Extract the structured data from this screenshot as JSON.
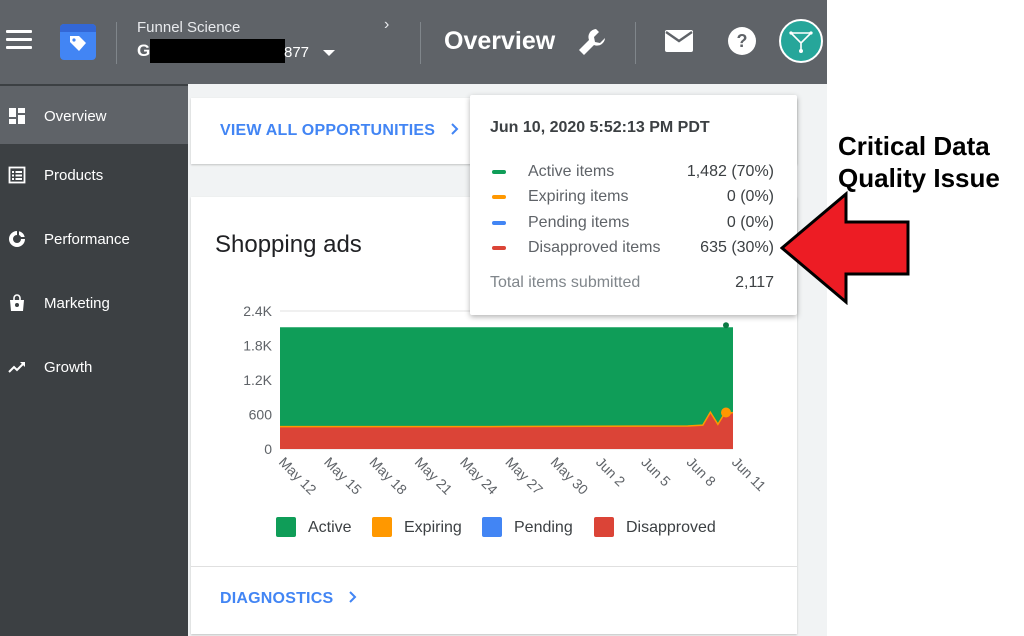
{
  "header": {
    "account_name": "Funnel Science",
    "account_id_prefix": "G",
    "account_id_suffix": "877",
    "breadcrumb_chevron": "›",
    "page_title": "Overview"
  },
  "sidebar": {
    "items": [
      {
        "label": "Overview",
        "icon": "overview-icon",
        "active": true
      },
      {
        "label": "Products",
        "icon": "products-icon"
      },
      {
        "label": "Performance",
        "icon": "performance-icon"
      },
      {
        "label": "Marketing",
        "icon": "marketing-icon"
      },
      {
        "label": "Growth",
        "icon": "growth-icon"
      }
    ]
  },
  "main": {
    "opportunities_link": "VIEW ALL OPPORTUNITIES",
    "shopping_card_title": "Shopping ads",
    "diagnostics_link": "DIAGNOSTICS"
  },
  "tooltip": {
    "date": "Jun 10, 2020 5:52:13 PM PDT",
    "rows": [
      {
        "label": "Active items",
        "value": "1,482 (70%)",
        "color": "#0f9d58"
      },
      {
        "label": "Expiring items",
        "value": "0 (0%)",
        "color": "#ff9800"
      },
      {
        "label": "Pending items",
        "value": "0 (0%)",
        "color": "#4285f4"
      },
      {
        "label": "Disapproved items",
        "value": "635 (30%)",
        "color": "#db4437"
      }
    ],
    "total_label": "Total items submitted",
    "total_value": "2,117"
  },
  "annotation": {
    "line1": "Critical Data",
    "line2": "Quality Issue"
  },
  "colors": {
    "active": "#0f9d58",
    "expiring": "#ff9800",
    "pending": "#4285f4",
    "disapproved": "#db4437",
    "annotation_arrow": "#ed1c24"
  },
  "chart_data": {
    "type": "area",
    "stacked": true,
    "y_ticks": [
      "0",
      "600",
      "1.2K",
      "1.8K",
      "2.4K"
    ],
    "ylim": [
      0,
      2400
    ],
    "x_tick_labels": [
      "May 12",
      "May 15",
      "May 18",
      "May 21",
      "May 24",
      "May 27",
      "May 30",
      "Jun 2",
      "Jun 5",
      "Jun 8",
      "Jun 11"
    ],
    "x_days": [
      0,
      30
    ],
    "series": [
      {
        "name": "Disapproved",
        "color": "#db4437",
        "points": [
          [
            0,
            390
          ],
          [
            14,
            390
          ],
          [
            27,
            400
          ],
          [
            28,
            415
          ],
          [
            28.5,
            640
          ],
          [
            29,
            430
          ],
          [
            29.4,
            600
          ],
          [
            30,
            635
          ]
        ]
      },
      {
        "name": "Active",
        "color": "#0f9d58",
        "points": [
          [
            0,
            1727
          ],
          [
            14,
            1727
          ],
          [
            27,
            1717
          ],
          [
            28,
            1702
          ],
          [
            28.5,
            1477
          ],
          [
            29,
            1687
          ],
          [
            29.4,
            1517
          ],
          [
            30,
            1482
          ]
        ]
      },
      {
        "name": "Expiring",
        "color": "#ff9800",
        "points": [
          [
            0,
            0
          ],
          [
            30,
            0
          ]
        ]
      },
      {
        "name": "Pending",
        "color": "#4285f4",
        "points": [
          [
            0,
            0
          ],
          [
            30,
            0
          ]
        ]
      }
    ],
    "legend": [
      "Active",
      "Expiring",
      "Pending",
      "Disapproved"
    ],
    "legend_position": "bottom"
  }
}
